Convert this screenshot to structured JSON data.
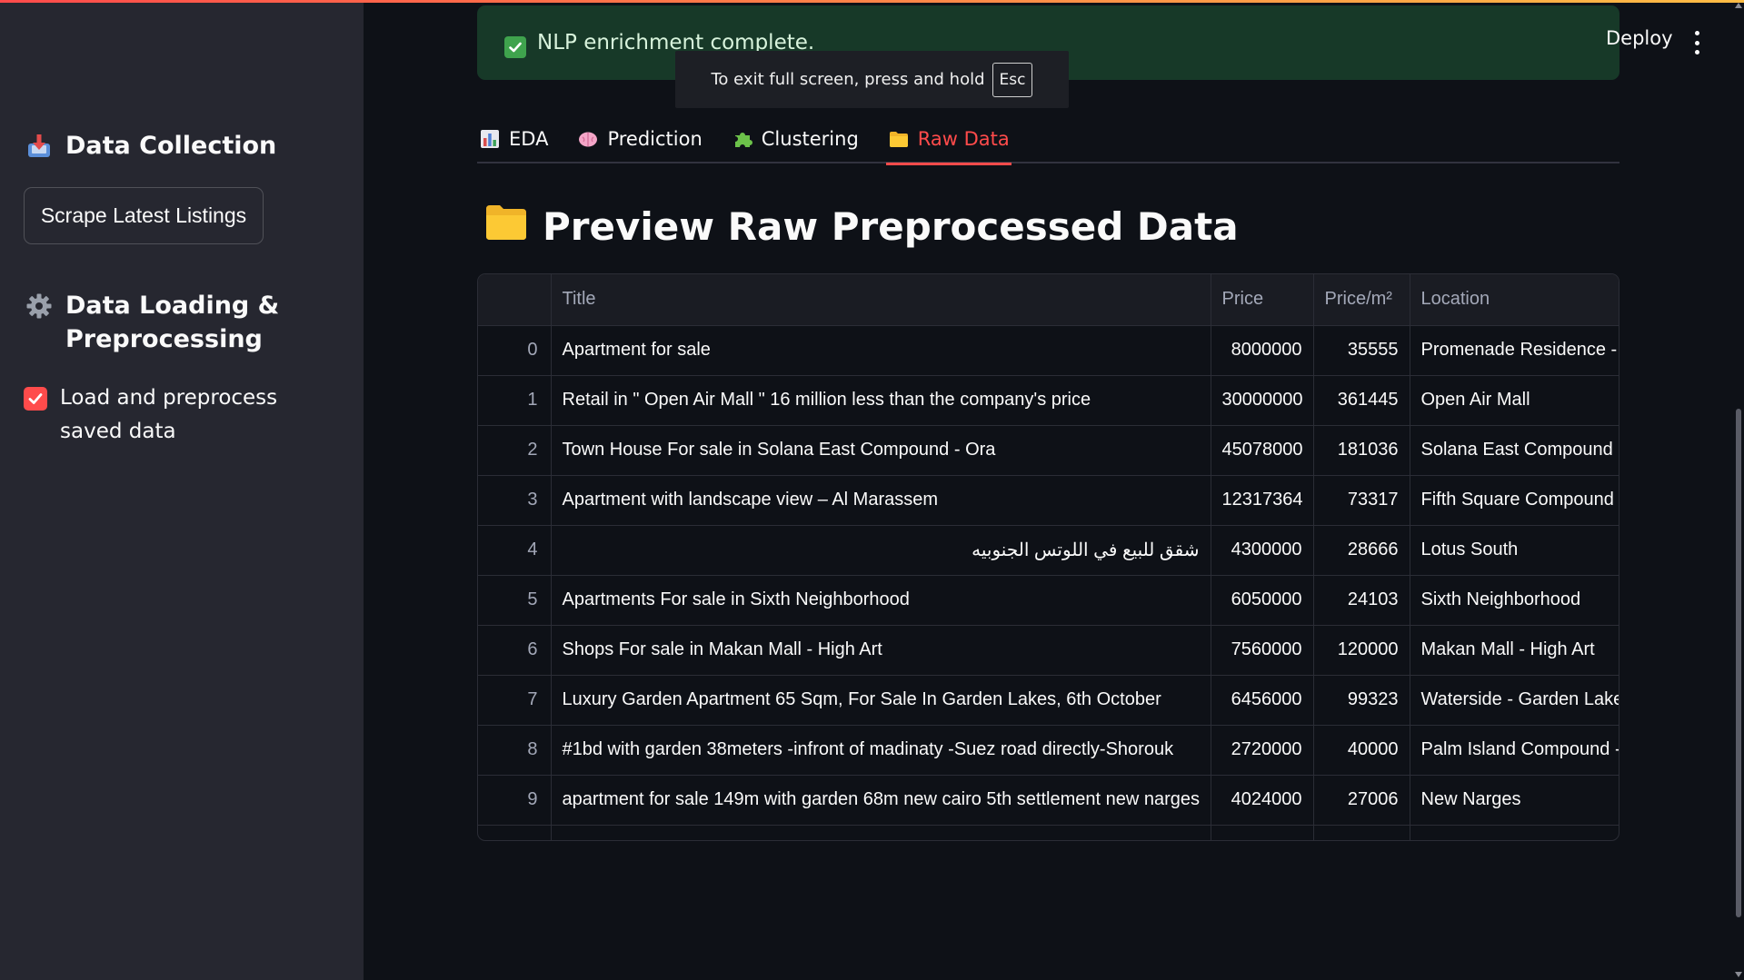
{
  "sidebar": {
    "data_collection_title": "Data Collection",
    "scrape_button_label": "Scrape Latest Listings",
    "data_loading_title": "Data Loading & Preprocessing",
    "checkbox_label": "Load and preprocess saved data",
    "checkbox_checked": true
  },
  "toast": {
    "message": "NLP enrichment complete."
  },
  "fullscreen_notice": {
    "text": "To exit full screen, press and hold",
    "key": "Esc"
  },
  "header": {
    "deploy_label": "Deploy"
  },
  "tabs": [
    {
      "label": "EDA",
      "icon": "bar-chart-icon",
      "active": false
    },
    {
      "label": "Prediction",
      "icon": "brain-icon",
      "active": false
    },
    {
      "label": "Clustering",
      "icon": "puzzle-icon",
      "active": false
    },
    {
      "label": "Raw Data",
      "icon": "folder-icon",
      "active": true
    }
  ],
  "main": {
    "title": "Preview Raw Preprocessed Data"
  },
  "table": {
    "columns": [
      "",
      "Title",
      "Price",
      "Price/m²",
      "Location"
    ],
    "rows": [
      {
        "index": "0",
        "title": "Apartment for sale",
        "price": "8000000",
        "price_m2": "35555",
        "location": "Promenade Residence - V"
      },
      {
        "index": "1",
        "title": "Retail in \" Open Air Mall \" 16 million less than the company's price",
        "price": "30000000",
        "price_m2": "361445",
        "location": "Open Air Mall"
      },
      {
        "index": "2",
        "title": "Town House For sale in Solana East Compound - Ora",
        "price": "45078000",
        "price_m2": "181036",
        "location": "Solana East Compound -"
      },
      {
        "index": "3",
        "title": "Apartment with landscape view – Al Marassem",
        "price": "12317364",
        "price_m2": "73317",
        "location": "Fifth Square Compound"
      },
      {
        "index": "4",
        "title": "شقق للبيع في اللوتس الجنوبيه",
        "price": "4300000",
        "price_m2": "28666",
        "location": "Lotus South"
      },
      {
        "index": "5",
        "title": "Apartments For sale in Sixth Neighborhood",
        "price": "6050000",
        "price_m2": "24103",
        "location": "Sixth Neighborhood"
      },
      {
        "index": "6",
        "title": "Shops For sale in Makan Mall - High Art",
        "price": "7560000",
        "price_m2": "120000",
        "location": "Makan Mall - High Art"
      },
      {
        "index": "7",
        "title": "Luxury Garden Apartment 65 Sqm, For Sale In Garden Lakes, 6th October",
        "price": "6456000",
        "price_m2": "99323",
        "location": "Waterside - Garden Lakes"
      },
      {
        "index": "8",
        "title": "#1bd with garden 38meters -infront of madinaty -Suez road directly-Shorouk",
        "price": "2720000",
        "price_m2": "40000",
        "location": "Palm Island Compound -"
      },
      {
        "index": "9",
        "title": "apartment for sale 149m with garden 68m new cairo 5th settlement new narges",
        "price": "4024000",
        "price_m2": "27006",
        "location": "New Narges"
      }
    ]
  },
  "colors": {
    "accent": "#ff4b4b",
    "sidebar_bg": "#262730",
    "main_bg": "#0e1117",
    "toast_bg": "#173928"
  }
}
